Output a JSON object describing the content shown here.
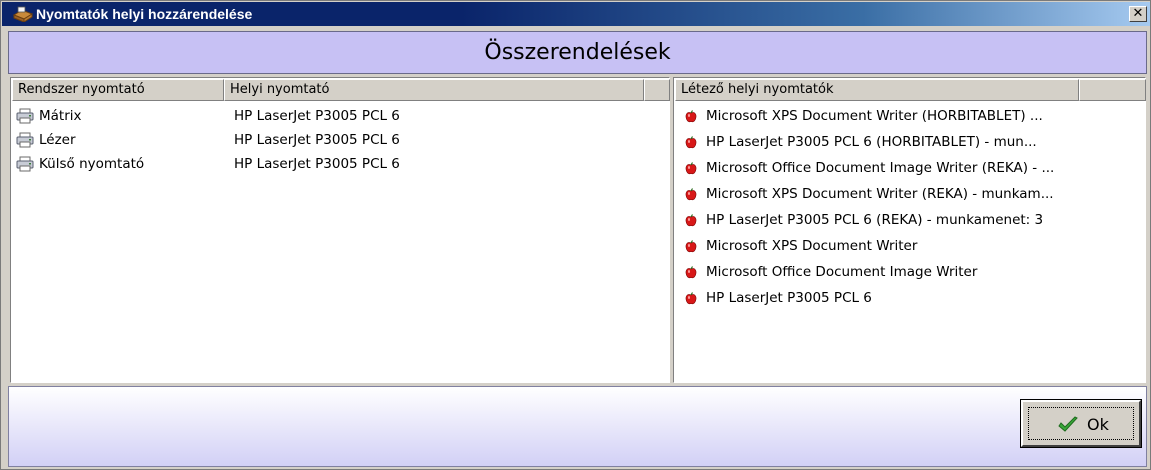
{
  "window": {
    "title": "Nyomtatók helyi hozzárendelése",
    "close_glyph": "✕",
    "icons": {
      "title": "printer-box-icon",
      "close": "close-icon"
    }
  },
  "section": {
    "title": "Összerendelések"
  },
  "assignments": {
    "columns": [
      "Rendszer nyomtató",
      "Helyi nyomtató",
      ""
    ],
    "rows": [
      {
        "system": "Mátrix",
        "local": "HP LaserJet P3005 PCL 6",
        "icon": "printer-icon"
      },
      {
        "system": "Lézer",
        "local": "HP LaserJet P3005 PCL 6",
        "icon": "printer-icon"
      },
      {
        "system": "Külső nyomtató",
        "local": "HP LaserJet P3005 PCL 6",
        "icon": "printer-icon"
      }
    ]
  },
  "existing": {
    "columns": [
      "Létező helyi nyomtatók",
      ""
    ],
    "items": [
      "Microsoft XPS Document Writer (HORBITABLET) ...",
      "HP LaserJet P3005 PCL 6 (HORBITABLET) - mun...",
      "Microsoft Office Document Image Writer (REKA) - ...",
      "Microsoft XPS Document Writer (REKA) - munkam...",
      "HP LaserJet P3005 PCL 6 (REKA) - munkamenet: 3",
      "Microsoft XPS Document Writer",
      "Microsoft Office Document Image Writer",
      "HP LaserJet P3005 PCL 6"
    ],
    "item_icon": "red-apple-icon"
  },
  "footer": {
    "ok_label": "Ok",
    "ok_icon": "green-checkmark-icon"
  },
  "colors": {
    "title_bar": "#0a246a",
    "section_header": "#c7c1f4",
    "footer_gradient_end": "#d2d0f6",
    "apple_red": "#d81818",
    "check_green": "#3aa83a"
  }
}
